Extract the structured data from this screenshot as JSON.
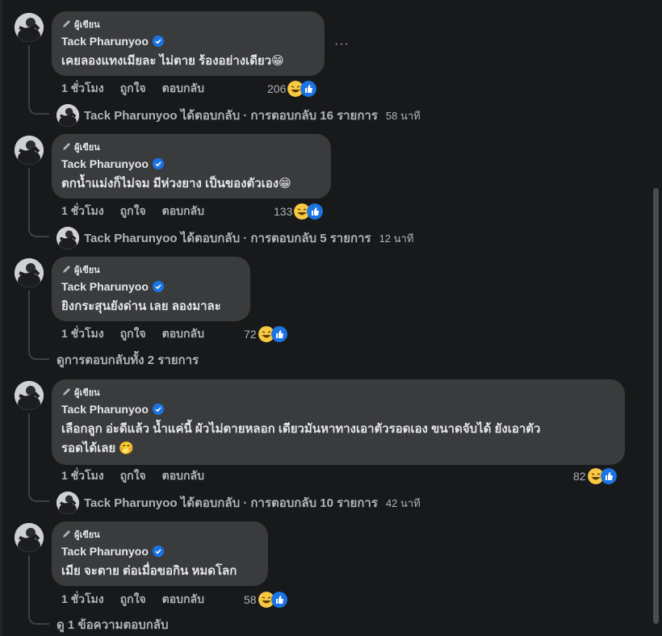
{
  "colors": {
    "bg": "#18191a",
    "bubble": "#3a3b3c",
    "verified": "#1b74e4",
    "muted": "#b0b3b8"
  },
  "comments": [
    {
      "badge": "ผู้เขียน",
      "author": "Tack Pharunyoo",
      "text": "เคยลองแทงเมียละ ไม่ตาย ร้องอย่างเดียว😁",
      "time": "1 ชั่วโมง",
      "like": "ถูกใจ",
      "reply": "ตอบกลับ",
      "reaction_count": "206",
      "more": "···",
      "thread": {
        "kind": "reply",
        "text": "Tack Pharunyoo ได้ตอบกลับ · การตอบกลับ 16 รายการ",
        "time": "58 นาที"
      }
    },
    {
      "badge": "ผู้เขียน",
      "author": "Tack Pharunyoo",
      "text": "ตกน้ำแม่งก็ไม่จม มีห่วงยาง เป็นของตัวเอง😁",
      "time": "1 ชั่วโมง",
      "like": "ถูกใจ",
      "reply": "ตอบกลับ",
      "reaction_count": "133",
      "thread": {
        "kind": "reply",
        "text": "Tack Pharunyoo ได้ตอบกลับ · การตอบกลับ 5 รายการ",
        "time": "12 นาที"
      }
    },
    {
      "badge": "ผู้เขียน",
      "author": "Tack Pharunyoo",
      "text": "ยิงกระสุนยังด่าน เลย ลองมาละ",
      "time": "1 ชั่วโมง",
      "like": "ถูกใจ",
      "reply": "ตอบกลับ",
      "reaction_count": "72",
      "thread": {
        "kind": "view",
        "text": "ดูการตอบกลับทั้ง 2 รายการ"
      }
    },
    {
      "badge": "ผู้เขียน",
      "author": "Tack Pharunyoo",
      "text_line1": "เลือกลูก อ่ะดีแล้ว น้ำแค่นี้ ผัวไม่ตายหลอก เดียวมันหาทางเอาตัวรอดเอง ขนาดจับได้ ยังเอาตัว",
      "text_line2": "รอดได้เลย 🤭",
      "time": "1 ชั่วโมง",
      "like": "ถูกใจ",
      "reply": "ตอบกลับ",
      "reaction_count": "82",
      "thread": {
        "kind": "reply",
        "text": "Tack Pharunyoo ได้ตอบกลับ · การตอบกลับ 10 รายการ",
        "time": "42 นาที"
      }
    },
    {
      "badge": "ผู้เขียน",
      "author": "Tack Pharunyoo",
      "text": "เมีย จะตาย ต่อเมื่อขอกิน หมดโลก",
      "time": "1 ชั่วโมง",
      "like": "ถูกใจ",
      "reply": "ตอบกลับ",
      "reaction_count": "58",
      "thread": {
        "kind": "view",
        "text": "ดู 1 ข้อความตอบกลับ"
      }
    }
  ]
}
